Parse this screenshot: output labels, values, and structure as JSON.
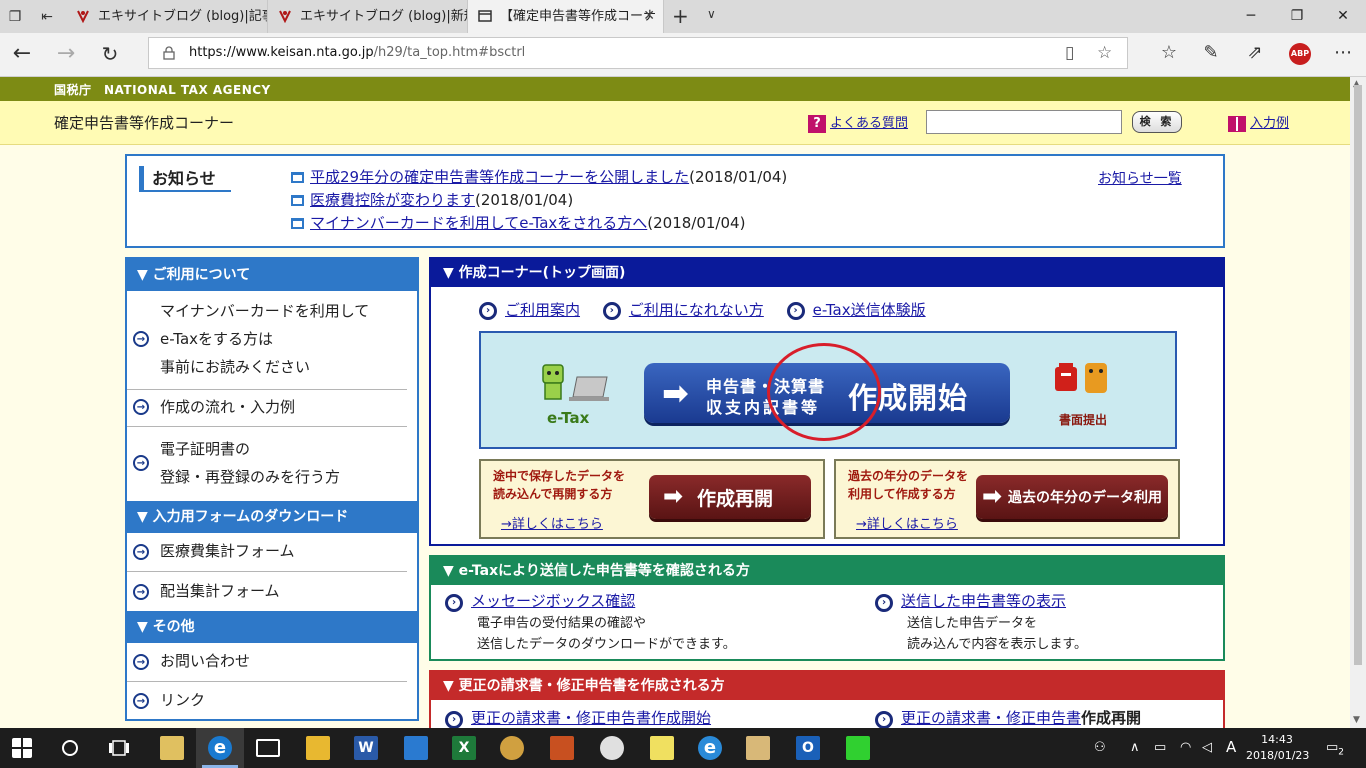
{
  "browser": {
    "tabs": [
      {
        "title": "エキサイトブログ (blog)|記事編"
      },
      {
        "title": "エキサイトブログ (blog)|新規投"
      },
      {
        "title": "【確定申告書等作成コーナ"
      }
    ],
    "url_prefix": "https://www.keisan.nta.go.jp",
    "url_path": "/h29/ta_top.htm#bsctrl",
    "abp_label": "ABP"
  },
  "header": {
    "agency": "国税庁　NATIONAL TAX AGENCY",
    "site_title": "確定申告書等作成コーナー",
    "faq_label": "よくある質問",
    "search_value": "",
    "search_button": "検 索",
    "example_label": "入力例"
  },
  "notice": {
    "title": "お知らせ",
    "items": [
      {
        "link": "平成29年分の確定申告書等作成コーナーを公開しました",
        "date": "(2018/01/04)"
      },
      {
        "link": "医療費控除が変わります",
        "date": "(2018/01/04)"
      },
      {
        "link": "マイナンバーカードを利用してe-Taxをされる方へ",
        "date": "(2018/01/04)"
      }
    ],
    "all_link": "お知らせ一覧"
  },
  "sidebar": {
    "sections": [
      {
        "title": "▼ ご利用について",
        "items": [
          {
            "lines": [
              "マイナンバーカードを利用して",
              "e-Taxをする方は",
              "事前にお読みください"
            ]
          },
          {
            "lines": [
              "作成の流れ・入力例"
            ]
          },
          {
            "lines": [
              "電子証明書の",
              "登録・再登録のみを行う方"
            ]
          }
        ]
      },
      {
        "title": "▼ 入力用フォームのダウンロード",
        "items": [
          {
            "lines": [
              "医療費集計フォーム"
            ]
          },
          {
            "lines": [
              "配当集計フォーム"
            ]
          }
        ]
      },
      {
        "title": "▼ その他",
        "items": [
          {
            "lines": [
              "お問い合わせ"
            ]
          },
          {
            "lines": [
              "リンク"
            ]
          }
        ]
      }
    ]
  },
  "main": {
    "top_panel": {
      "title": "▼ 作成コーナー(トップ画面)",
      "links": [
        "ご利用案内",
        "ご利用になれない方",
        "e-Tax送信体験版"
      ],
      "etax_label": "e-Tax",
      "start_sub1": "申告書・決算書",
      "start_sub2": "収支内訳書等",
      "start_main": "作成開始",
      "paper_label": "書面提出",
      "resume": {
        "desc1": "途中で保存したデータを",
        "desc2": "読み込んで再開する方",
        "more": "→詳しくはこちら",
        "button": "作成再開"
      },
      "past": {
        "desc1": "過去の年分のデータを",
        "desc2": "利用して作成する方",
        "more": "→詳しくはこちら",
        "button": "過去の年分のデータ利用"
      }
    },
    "etax_panel": {
      "title": "▼ e-Taxにより送信した申告書等を確認される方",
      "left_link": "メッセージボックス確認",
      "left_desc1": "電子申告の受付結果の確認や",
      "left_desc2": "送信したデータのダウンロードができます。",
      "right_link": "送信した申告書等の表示",
      "right_desc1": "送信した申告データを",
      "right_desc2": "読み込んで内容を表示します。"
    },
    "correction_panel": {
      "title": "▼ 更正の請求書・修正申告書を作成される方",
      "left_link": "更正の請求書・修正申告書作成開始",
      "right_link": "更正の請求書・修正申告書",
      "right_bold": "作成再開"
    }
  },
  "taskbar": {
    "time": "14:43",
    "date": "2018/01/23",
    "ime": "A",
    "notifications": "2"
  },
  "colors": {
    "nta_green": "#7d8b14",
    "header_yellow": "#fffbb4",
    "sidebar_blue": "#2e78c8",
    "panel_navy": "#0a1a9a",
    "panel_green": "#1a8a5a",
    "panel_red": "#c42a2a",
    "highlight_circle": "#d81e2a"
  }
}
